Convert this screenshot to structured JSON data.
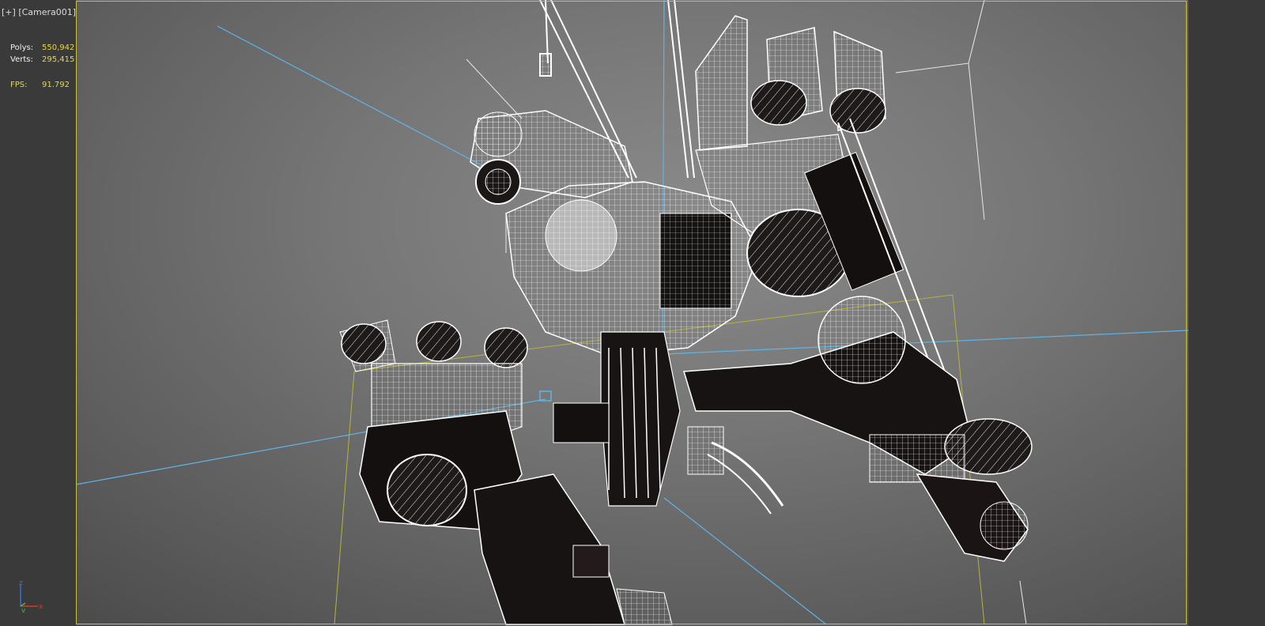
{
  "viewport": {
    "plus_label": "[+]",
    "camera_label": "[Camera001]"
  },
  "stats": {
    "polys_label": "Polys:",
    "polys_value": "550,942",
    "verts_label": "Verts:",
    "verts_value": "295,415",
    "fps_label": "FPS:",
    "fps_value": "91.792"
  },
  "axis_gizmo": {
    "z": "z",
    "y": "y",
    "x": "x"
  },
  "colors": {
    "safe_frame": "#c8c23a",
    "stat_value": "#e8d64a",
    "camera_line": "#5fb4e6",
    "wire": "#ffffff",
    "axis_x": "#d23b2b",
    "axis_y": "#3ec23e",
    "axis_z": "#3b6fd2"
  }
}
